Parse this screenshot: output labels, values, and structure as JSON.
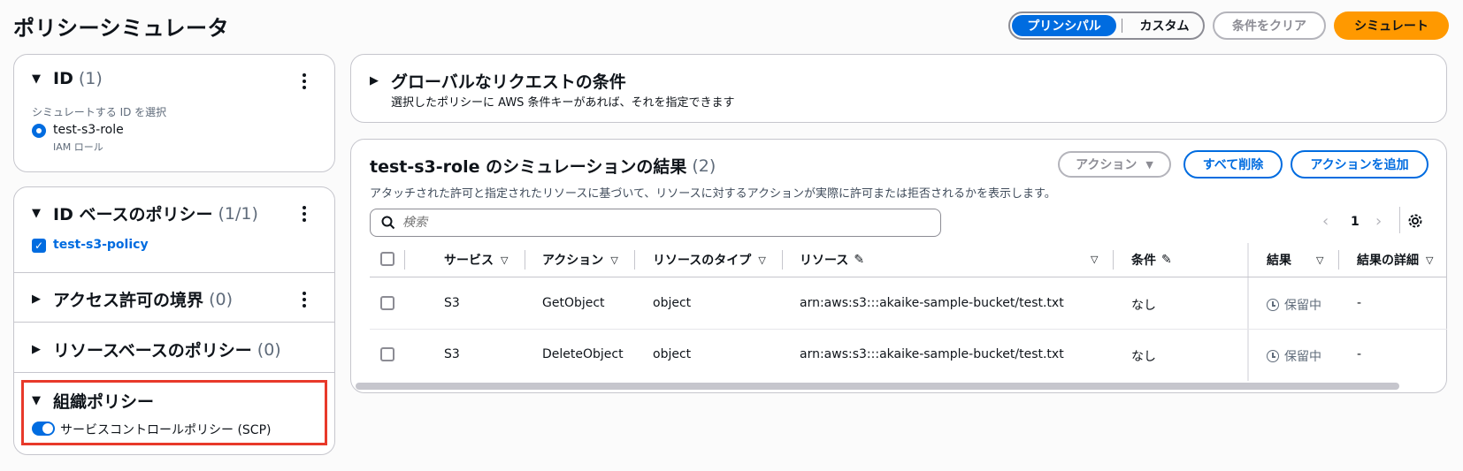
{
  "page": {
    "title": "ポリシーシミュレータ"
  },
  "toolbar": {
    "principal": "プリンシパル",
    "custom": "カスタム",
    "clear": "条件をクリア",
    "simulate": "シミュレート"
  },
  "identity": {
    "title": "ID",
    "count": "(1)",
    "select_label": "シミュレートする ID を選択",
    "role_name": "test-s3-role",
    "role_type": "IAM ロール"
  },
  "id_policies": {
    "title": "ID ベースのポリシー",
    "count": "(1/1)",
    "policy": "test-s3-policy"
  },
  "boundary": {
    "title": "アクセス許可の境界",
    "count": "(0)"
  },
  "resource_policies": {
    "title": "リソースベースのポリシー",
    "count": "(0)"
  },
  "org_policies": {
    "title": "組織ポリシー",
    "scp_label": "サービスコントロールポリシー (SCP)",
    "scp_enabled": true
  },
  "global_conditions": {
    "title": "グローバルなリクエストの条件",
    "description": "選択したポリシーに AWS 条件キーがあれば、それを指定できます"
  },
  "results": {
    "title": "test-s3-role のシミュレーションの結果",
    "count": "(2)",
    "description": "アタッチされた許可と指定されたリソースに基づいて、リソースに対するアクションが実際に許可または拒否されるかを表示します。",
    "actions_btn": "アクション",
    "delete_all_btn": "すべて削除",
    "add_action_btn": "アクションを追加",
    "search_placeholder": "検索",
    "page_number": "1",
    "columns": [
      "サービス",
      "アクション",
      "リソースのタイプ",
      "リソース",
      "条件",
      "結果",
      "結果の詳細"
    ],
    "rows": [
      {
        "service": "S3",
        "action": "GetObject",
        "resource_type": "object",
        "resource": "arn:aws:s3:::akaike-sample-bucket/test.txt",
        "condition": "なし",
        "result": "保留中",
        "detail": "-"
      },
      {
        "service": "S3",
        "action": "DeleteObject",
        "resource_type": "object",
        "resource": "arn:aws:s3:::akaike-sample-bucket/test.txt",
        "condition": "なし",
        "result": "保留中",
        "detail": "-"
      }
    ]
  }
}
